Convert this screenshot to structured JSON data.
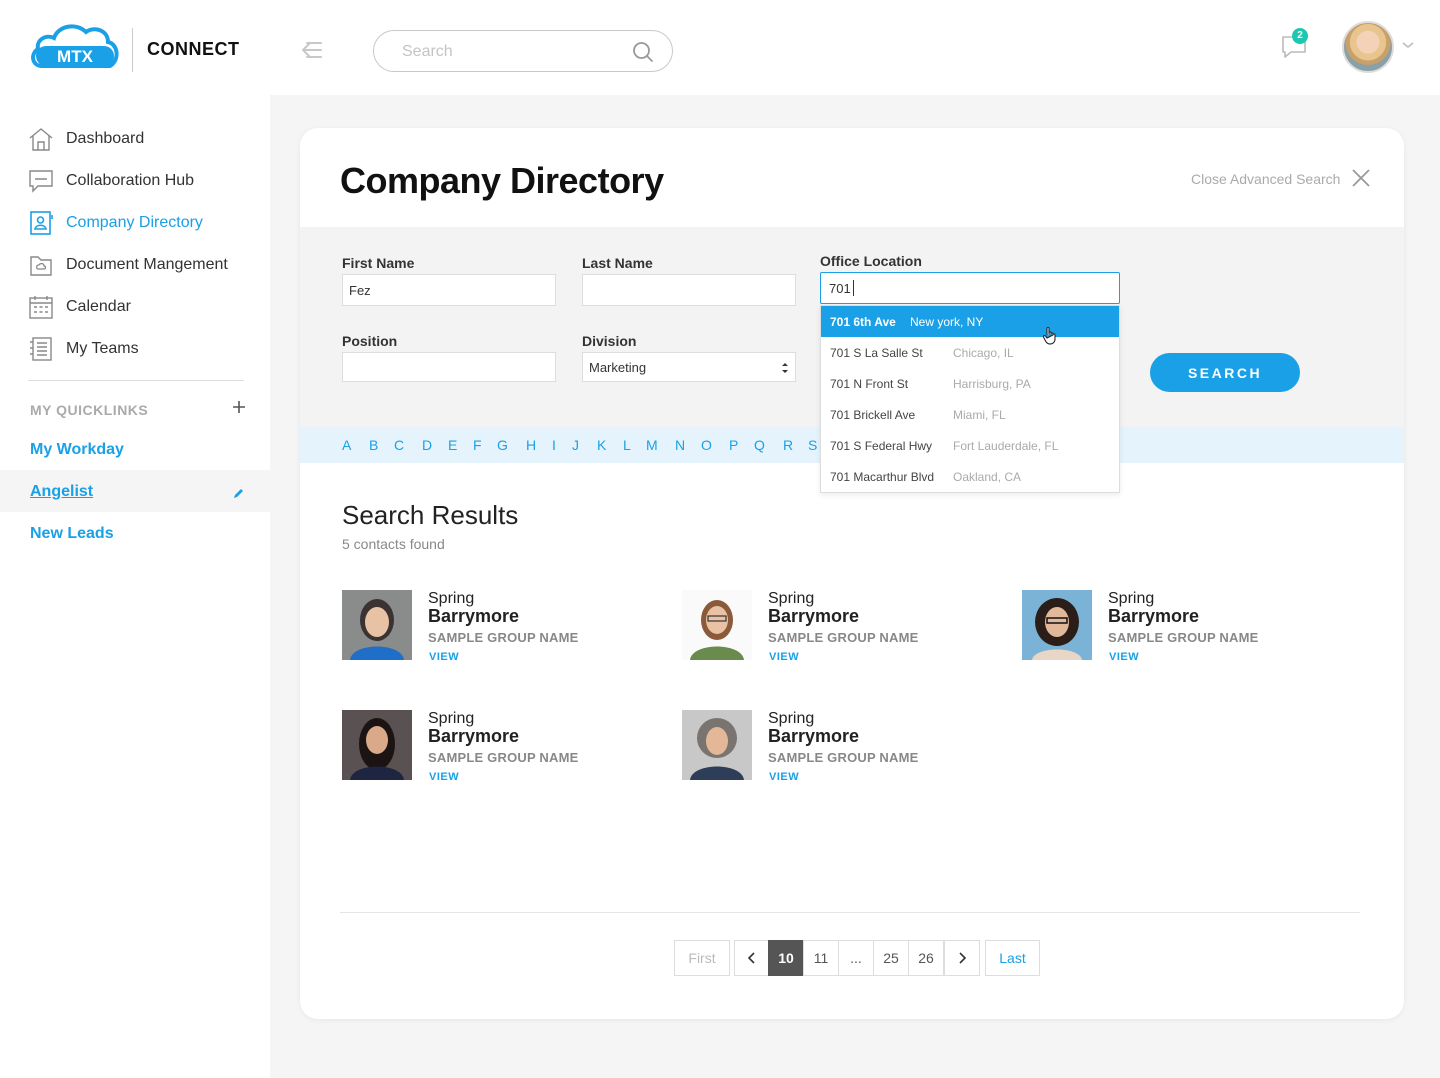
{
  "header": {
    "logo_text": "MTX",
    "brand": "CONNECT",
    "search_placeholder": "Search",
    "chat_badge": "2"
  },
  "sidebar": {
    "items": [
      {
        "label": "Dashboard",
        "icon": "home-icon"
      },
      {
        "label": "Collaboration Hub",
        "icon": "chat-bubble-icon"
      },
      {
        "label": "Company Directory",
        "icon": "contact-card-icon",
        "active": true
      },
      {
        "label": "Document Mangement",
        "icon": "folder-icon"
      },
      {
        "label": "Calendar",
        "icon": "calendar-icon"
      },
      {
        "label": "My Teams",
        "icon": "teams-list-icon"
      }
    ],
    "quicklinks_title": "MY QUICKLINKS",
    "quicklinks": [
      "My Workday",
      "Angelist",
      "New Leads"
    ]
  },
  "main": {
    "title": "Company Directory",
    "close_advanced": "Close Advanced Search",
    "filters": {
      "first_name_label": "First Name",
      "first_name_value": "Fez",
      "last_name_label": "Last Name",
      "last_name_value": "",
      "office_location_label": "Office Location",
      "office_location_value": "701",
      "position_label": "Position",
      "position_value": "",
      "division_label": "Division",
      "division_value": "Marketing",
      "search_button": "SEARCH"
    },
    "location_suggestions": [
      {
        "street": "701 6th Ave",
        "city": "New york, NY"
      },
      {
        "street": "701 S La Salle St",
        "city": "Chicago, IL"
      },
      {
        "street": "701 N Front St",
        "city": "Harrisburg, PA"
      },
      {
        "street": "701 Brickell Ave",
        "city": "Miami, FL"
      },
      {
        "street": "701 S Federal Hwy",
        "city": "Fort Lauderdale, FL"
      },
      {
        "street": "701 Macarthur Blvd",
        "city": "Oakland, CA"
      }
    ],
    "alphabet": [
      "A",
      "B",
      "C",
      "D",
      "E",
      "F",
      "G",
      "H",
      "I",
      "J",
      "K",
      "L",
      "M",
      "N",
      "O",
      "P",
      "Q",
      "R",
      "S"
    ],
    "results_title": "Search Results",
    "results_count": "5 contacts found",
    "contacts": [
      {
        "first": "Spring",
        "last": "Barrymore",
        "group": "SAMPLE GROUP NAME",
        "view": "VIEW"
      },
      {
        "first": "Spring",
        "last": "Barrymore",
        "group": "SAMPLE GROUP NAME",
        "view": "VIEW"
      },
      {
        "first": "Spring",
        "last": "Barrymore",
        "group": "SAMPLE GROUP NAME",
        "view": "VIEW"
      },
      {
        "first": "Spring",
        "last": "Barrymore",
        "group": "SAMPLE GROUP NAME",
        "view": "VIEW"
      },
      {
        "first": "Spring",
        "last": "Barrymore",
        "group": "SAMPLE GROUP NAME",
        "view": "VIEW"
      }
    ],
    "pagination": {
      "first": "First",
      "prev": "‹",
      "pages": [
        "10",
        "11",
        "...",
        "25",
        "26"
      ],
      "current": "10",
      "next": "›",
      "last": "Last"
    }
  },
  "colors": {
    "accent": "#1aa0e6",
    "badge": "#1ec8b0"
  }
}
